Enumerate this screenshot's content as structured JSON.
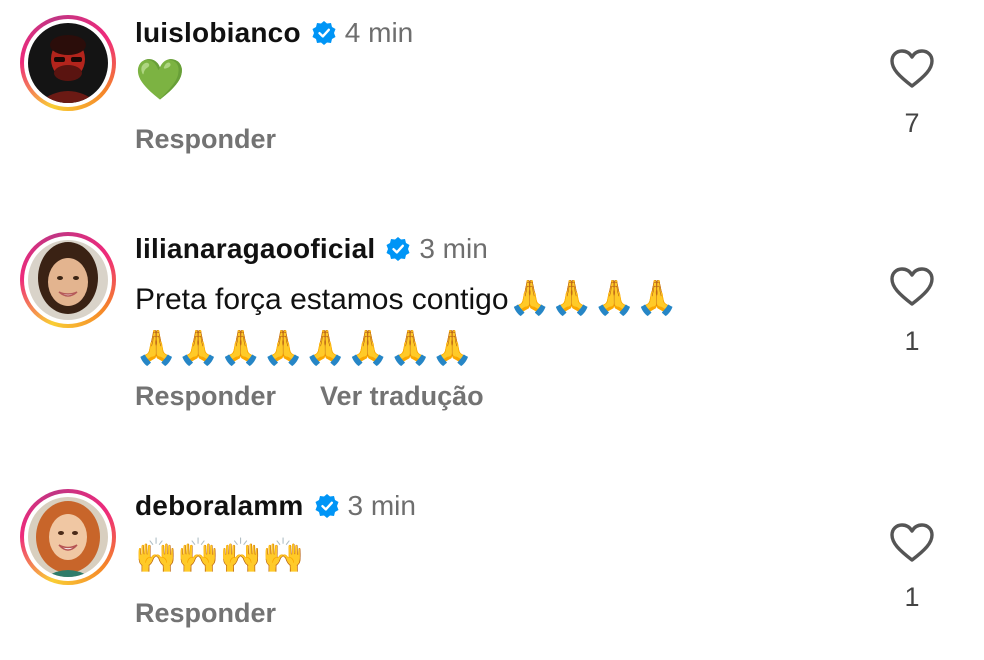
{
  "comments": [
    {
      "username": "luislobianco",
      "time": "4 min",
      "text": "",
      "emoji_line_1": "💚",
      "emoji_line_2": "",
      "actions": [
        "Responder"
      ],
      "likes": "7"
    },
    {
      "username": "lilianaragaooficial",
      "time": "3 min",
      "text": "Preta força estamos contigo",
      "emoji_line_1": "🙏🙏🙏🙏",
      "emoji_line_2": "🙏🙏🙏🙏🙏🙏🙏🙏",
      "actions": [
        "Responder",
        "Ver tradução"
      ],
      "likes": "1"
    },
    {
      "username": "deboralamm",
      "time": "3 min",
      "text": "",
      "emoji_line_1": "🙌🙌🙌🙌",
      "emoji_line_2": "",
      "actions": [
        "Responder"
      ],
      "likes": "1"
    }
  ],
  "colors": {
    "verified": "#0095f6",
    "secondary_text": "#737373",
    "ring_start": "#f9ce34",
    "ring_mid": "#ee2a7b",
    "ring_end": "#c13584"
  },
  "icons": {
    "verified": "verified-badge-icon",
    "like": "heart-outline-icon"
  }
}
